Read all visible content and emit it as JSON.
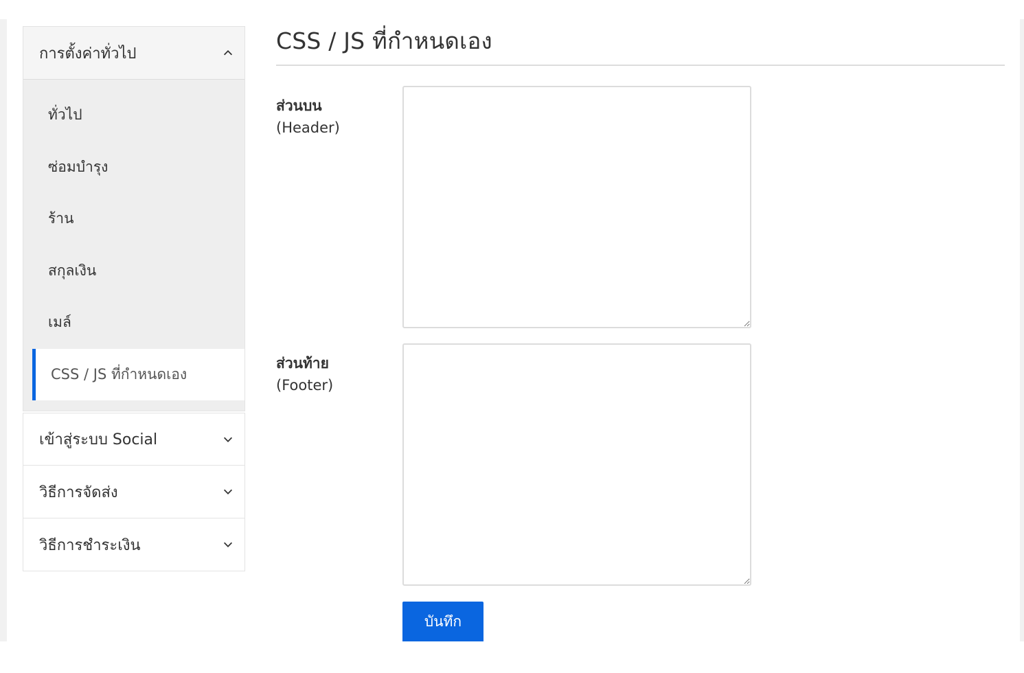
{
  "sidebar": {
    "general_group": {
      "label": "การตั้งค่าทั่วไป",
      "expanded": true,
      "items": [
        {
          "label": "ทั่วไป"
        },
        {
          "label": "ซ่อมบำรุง"
        },
        {
          "label": "ร้าน"
        },
        {
          "label": "สกุลเงิน"
        },
        {
          "label": "เมล์"
        },
        {
          "label": "CSS / JS ที่กำหนดเอง",
          "active": true
        }
      ]
    },
    "social_group": {
      "label": "เข้าสู่ระบบ Social",
      "expanded": false
    },
    "shipping_group": {
      "label": "วิธีการจัดส่ง",
      "expanded": false
    },
    "payment_group": {
      "label": "วิธีการชำระเงิน",
      "expanded": false
    }
  },
  "main": {
    "title": "CSS / JS ที่กำหนดเอง",
    "header_field": {
      "label": "ส่วนบน",
      "sublabel": "(Header)",
      "value": ""
    },
    "footer_field": {
      "label": "ส่วนท้าย",
      "sublabel": "(Footer)",
      "value": ""
    },
    "save_label": "บันทึก"
  },
  "colors": {
    "accent": "#0a66e0",
    "sidebar_bg": "#eeeeee",
    "header_bg": "#f5f5f5",
    "border": "#dddddd"
  },
  "icons": {
    "chevron_up": "chevron-up-icon",
    "chevron_down": "chevron-down-icon"
  }
}
